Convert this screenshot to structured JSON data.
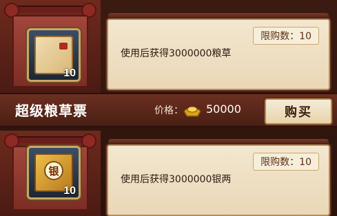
{
  "items": [
    {
      "title": "超级粮草票",
      "quantity_badge": "10",
      "description": "使用后获得3000000粮草",
      "limit_label": "限购数：10",
      "price_label": "价格：",
      "price": "50000",
      "buy_label": "购买",
      "icon": "grain-ticket-icon"
    },
    {
      "quantity_badge": "10",
      "description": "使用后获得3000000银两",
      "limit_label": "限购数：10",
      "icon": "silver-ticket-icon",
      "icon_glyph": "银"
    }
  ],
  "colors": {
    "accent_gold": "#caa865",
    "frame_red": "#7b2d24",
    "parchment": "#f3e7cf"
  }
}
